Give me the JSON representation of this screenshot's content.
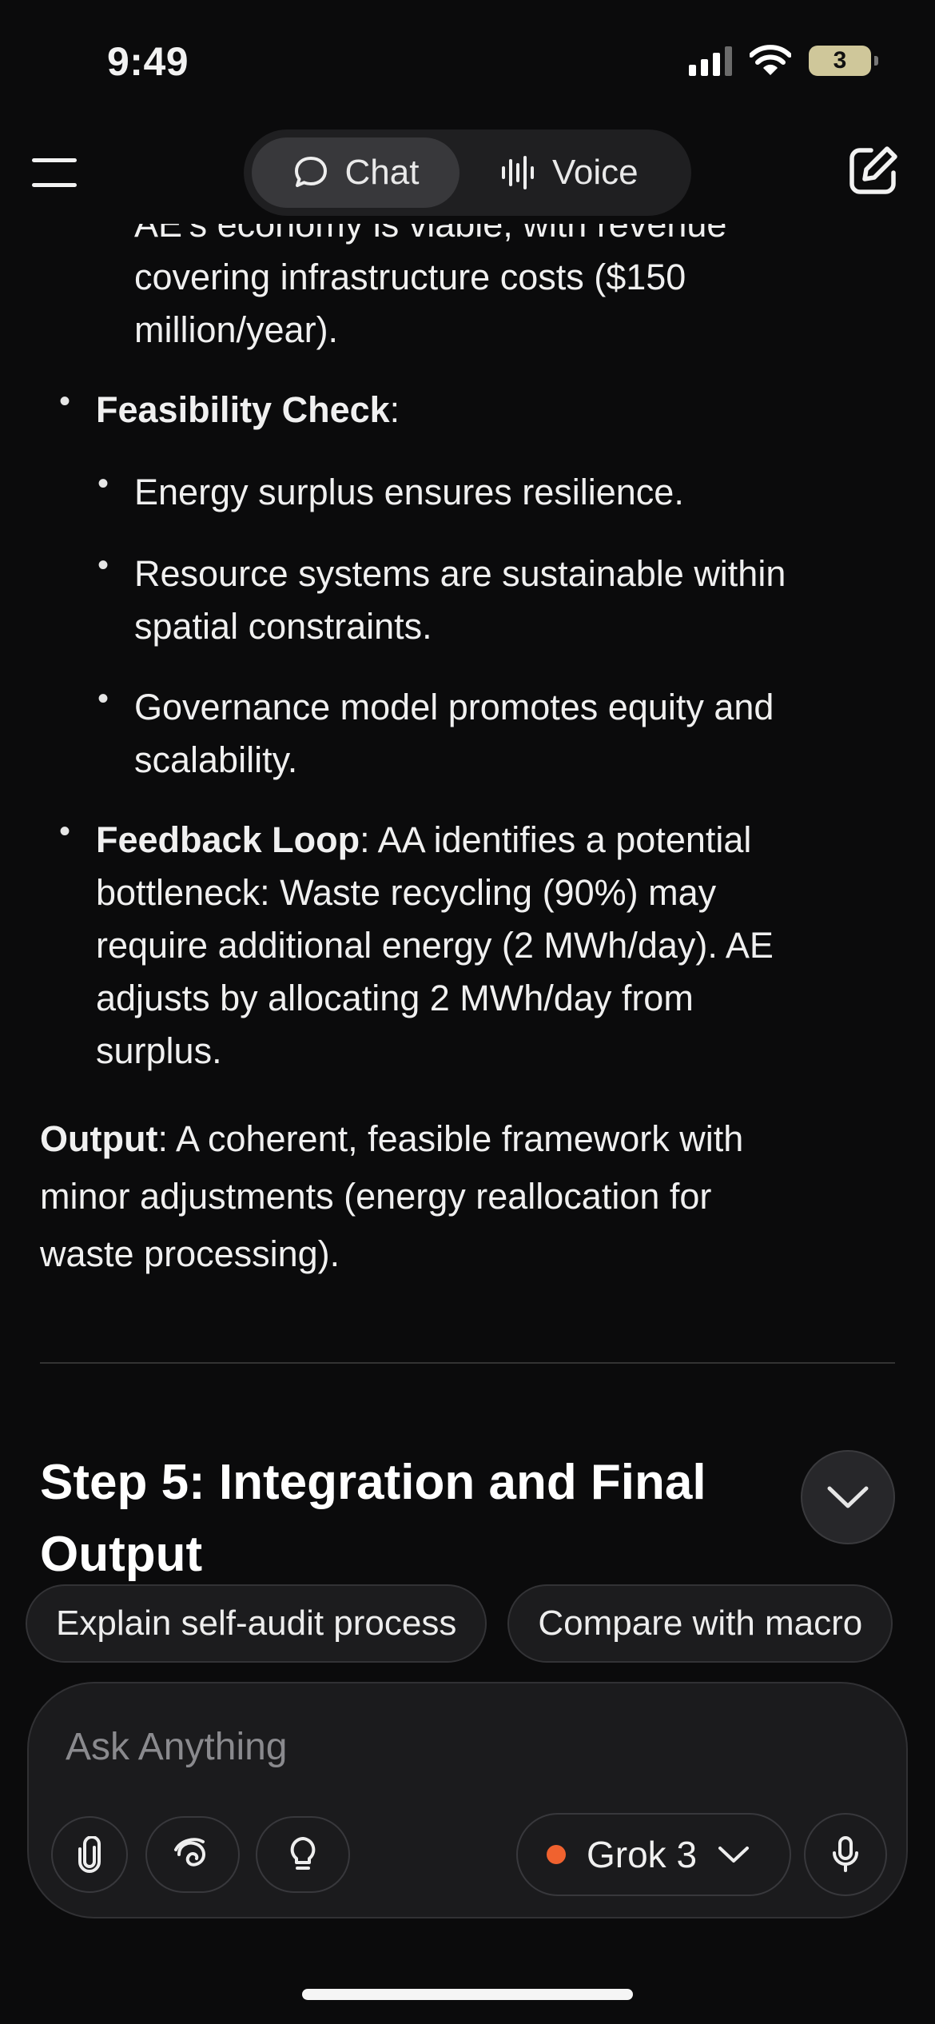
{
  "status_bar": {
    "time": "9:49",
    "battery_level": "3",
    "icons": [
      "signal-icon",
      "wifi-icon",
      "battery-icon"
    ]
  },
  "header": {
    "menu_icon": "hamburger-menu-icon",
    "tabs": [
      {
        "label": "Chat",
        "icon": "chat-bubble-icon",
        "active": true
      },
      {
        "label": "Voice",
        "icon": "waveform-icon",
        "active": false
      }
    ],
    "new_chat_icon": "edit-icon"
  },
  "content": {
    "clipped_line": "AE's economy is viable, with revenue",
    "intro_lines": [
      "covering infrastructure costs ($150",
      "million/year)."
    ],
    "feasibility": {
      "title": "Feasibility Check",
      "colon": ":",
      "items": [
        {
          "lines": [
            "Energy surplus ensures resilience."
          ]
        },
        {
          "lines": [
            "Resource systems are sustainable within",
            "spatial constraints."
          ]
        },
        {
          "lines": [
            "Governance model promotes equity and",
            "scalability."
          ]
        }
      ]
    },
    "feedback": {
      "title": "Feedback Loop",
      "first_line_rest": ": AA identifies a potential",
      "lines": [
        "bottleneck: Waste recycling (90%) may",
        "require additional energy (2 MWh/day). AE",
        "adjusts by allocating 2 MWh/day from",
        "surplus."
      ]
    },
    "output": {
      "title": "Output",
      "first_line_rest": ": A coherent, feasible framework with",
      "lines": [
        "minor adjustments (energy reallocation for",
        "waste processing)."
      ]
    },
    "step_heading": "Step 5: Integration and Final Output"
  },
  "suggestions": [
    "Explain self-audit process",
    "Compare with macro"
  ],
  "composer": {
    "placeholder": "Ask Anything",
    "value": "",
    "model": "Grok 3",
    "model_dot_color": "#f0622f",
    "buttons": [
      "paperclip-icon",
      "deepsearch-icon",
      "lightbulb-icon",
      "microphone-icon"
    ]
  },
  "scroll_button_icon": "chevron-down-icon"
}
